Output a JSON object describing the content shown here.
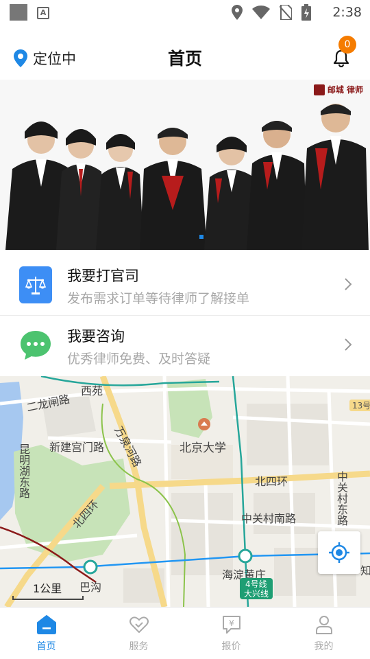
{
  "status_bar": {
    "time": "2:38"
  },
  "header": {
    "location_label": "定位中",
    "title": "首页",
    "notification_count": "0"
  },
  "banner": {
    "logo_text": "邮城 律师"
  },
  "menu": [
    {
      "title": "我要打官司",
      "subtitle": "发布需求订单等待律师了解接单",
      "icon": "scales-icon",
      "icon_color": "#3d8ef5"
    },
    {
      "title": "我要咨询",
      "subtitle": "优秀律师免费、及时答疑",
      "icon": "chat-bubble-icon",
      "icon_color": "#4cc36f"
    }
  ],
  "map": {
    "labels": {
      "xiyuan": "西苑",
      "erlongzha": "二龙闸路",
      "wanquanhe": "万泉河路",
      "xinjiangongmen": "新建宫门路",
      "pku": "北京大学",
      "kunminghu": "昆明湖东路",
      "beisihuan": "北四环",
      "beisihuan_v": "北四环",
      "zhongguancun_east": "中关村东路",
      "zhongguancun_south": "中关村南路",
      "haidianhuangzhuang": "海淀黄庄",
      "line4": "4号线",
      "daxingxian": "大兴线",
      "bagou": "巴沟",
      "line13": "13号",
      "zhi": "知"
    },
    "scale": "1公里"
  },
  "tabs": [
    {
      "label": "首页",
      "icon": "home-icon",
      "active": true
    },
    {
      "label": "服务",
      "icon": "heart-icon",
      "active": false
    },
    {
      "label": "报价",
      "icon": "quote-icon",
      "active": false
    },
    {
      "label": "我的",
      "icon": "user-icon",
      "active": false
    }
  ],
  "colors": {
    "accent": "#1e88e5",
    "badge": "#f57c00",
    "inactive": "#aaaaaa"
  }
}
